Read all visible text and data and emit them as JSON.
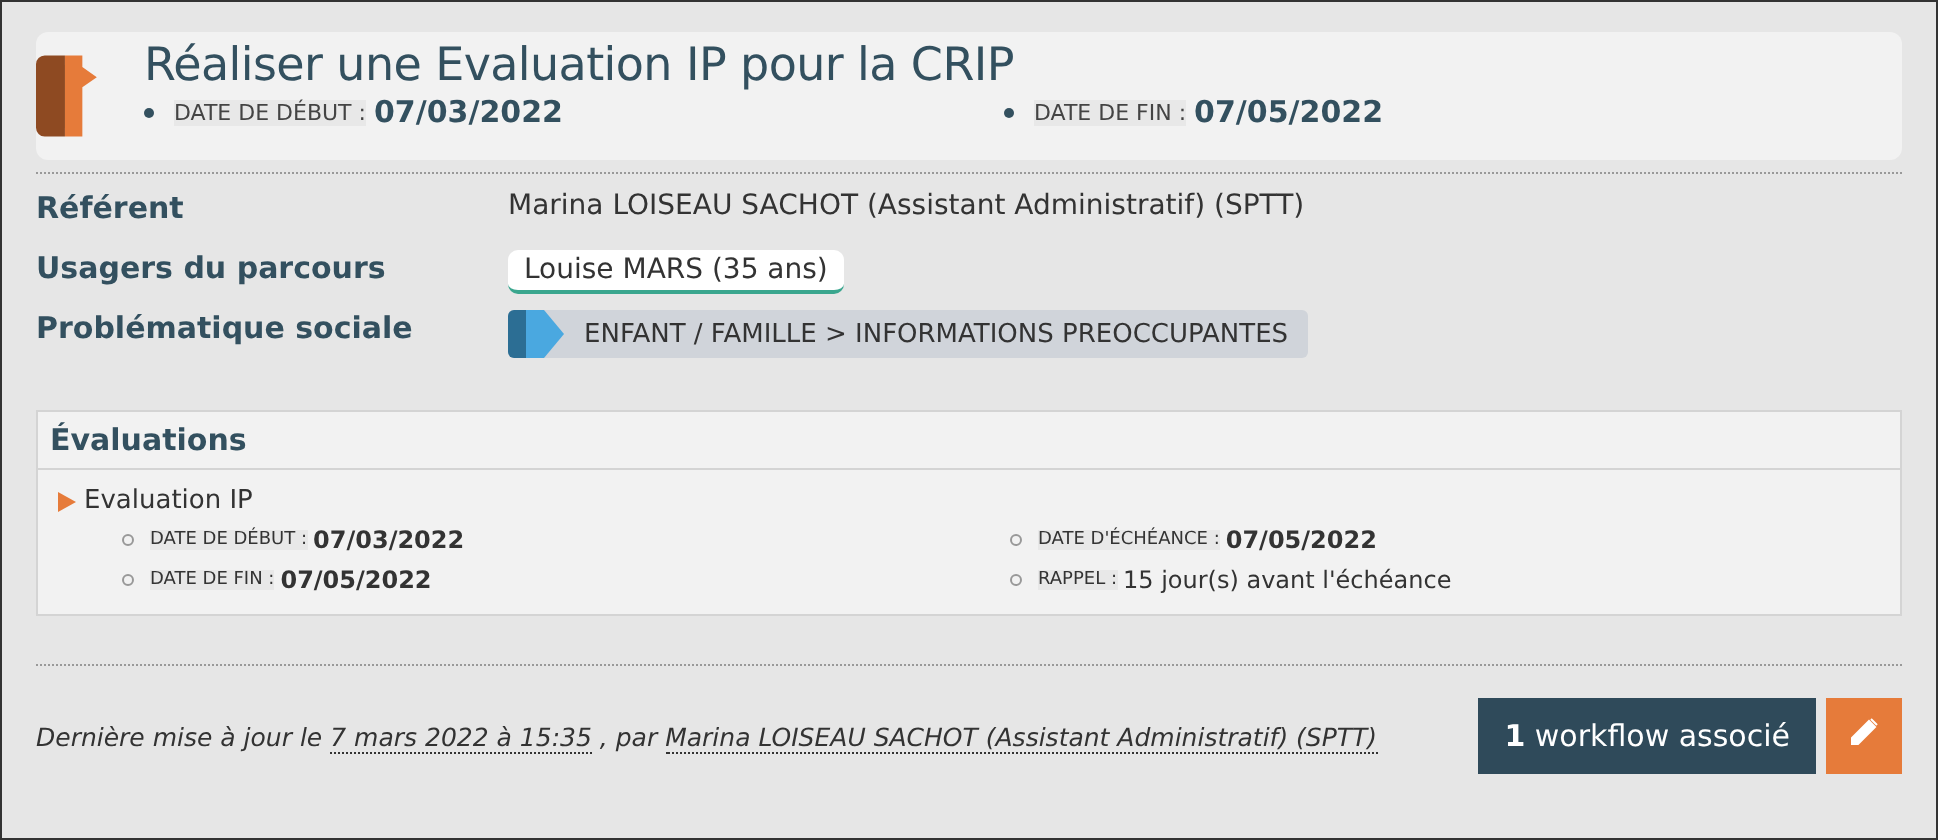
{
  "header": {
    "title": "Réaliser une Evaluation IP pour la CRIP",
    "dates": [
      {
        "label": "DATE DE DÉBUT :",
        "value": "07/03/2022"
      },
      {
        "label": "DATE DE FIN :",
        "value": "07/05/2022"
      }
    ]
  },
  "details": [
    {
      "kind": "text",
      "label": "Référent",
      "value": "Marina LOISEAU SACHOT (Assistant Administratif) (SPTT)"
    },
    {
      "kind": "chip",
      "label": "Usagers du parcours",
      "value": "Louise MARS (35 ans)"
    },
    {
      "kind": "tag",
      "label": "Problématique sociale",
      "value": "ENFANT / FAMILLE > INFORMATIONS PREOCCUPANTES"
    }
  ],
  "evaluations": {
    "title": "Évaluations",
    "items": [
      {
        "name": "Evaluation IP",
        "fields": [
          {
            "label": "DATE DE DÉBUT :",
            "value": "07/03/2022",
            "bold": true
          },
          {
            "label": "DATE D'ÉCHÉANCE :",
            "value": "07/05/2022",
            "bold": true
          },
          {
            "label": "DATE DE FIN :",
            "value": "07/05/2022",
            "bold": true
          },
          {
            "label": "RAPPEL :",
            "value": "15 jour(s) avant l'échéance",
            "bold": false
          }
        ]
      }
    ]
  },
  "footer": {
    "prefix": "Dernière mise à jour le",
    "date": "7 mars 2022 à 15:35",
    "middle": ", par",
    "author": "Marina LOISEAU SACHOT (Assistant Administratif) (SPTT)",
    "workflow_button": "**1** workflow associé"
  }
}
